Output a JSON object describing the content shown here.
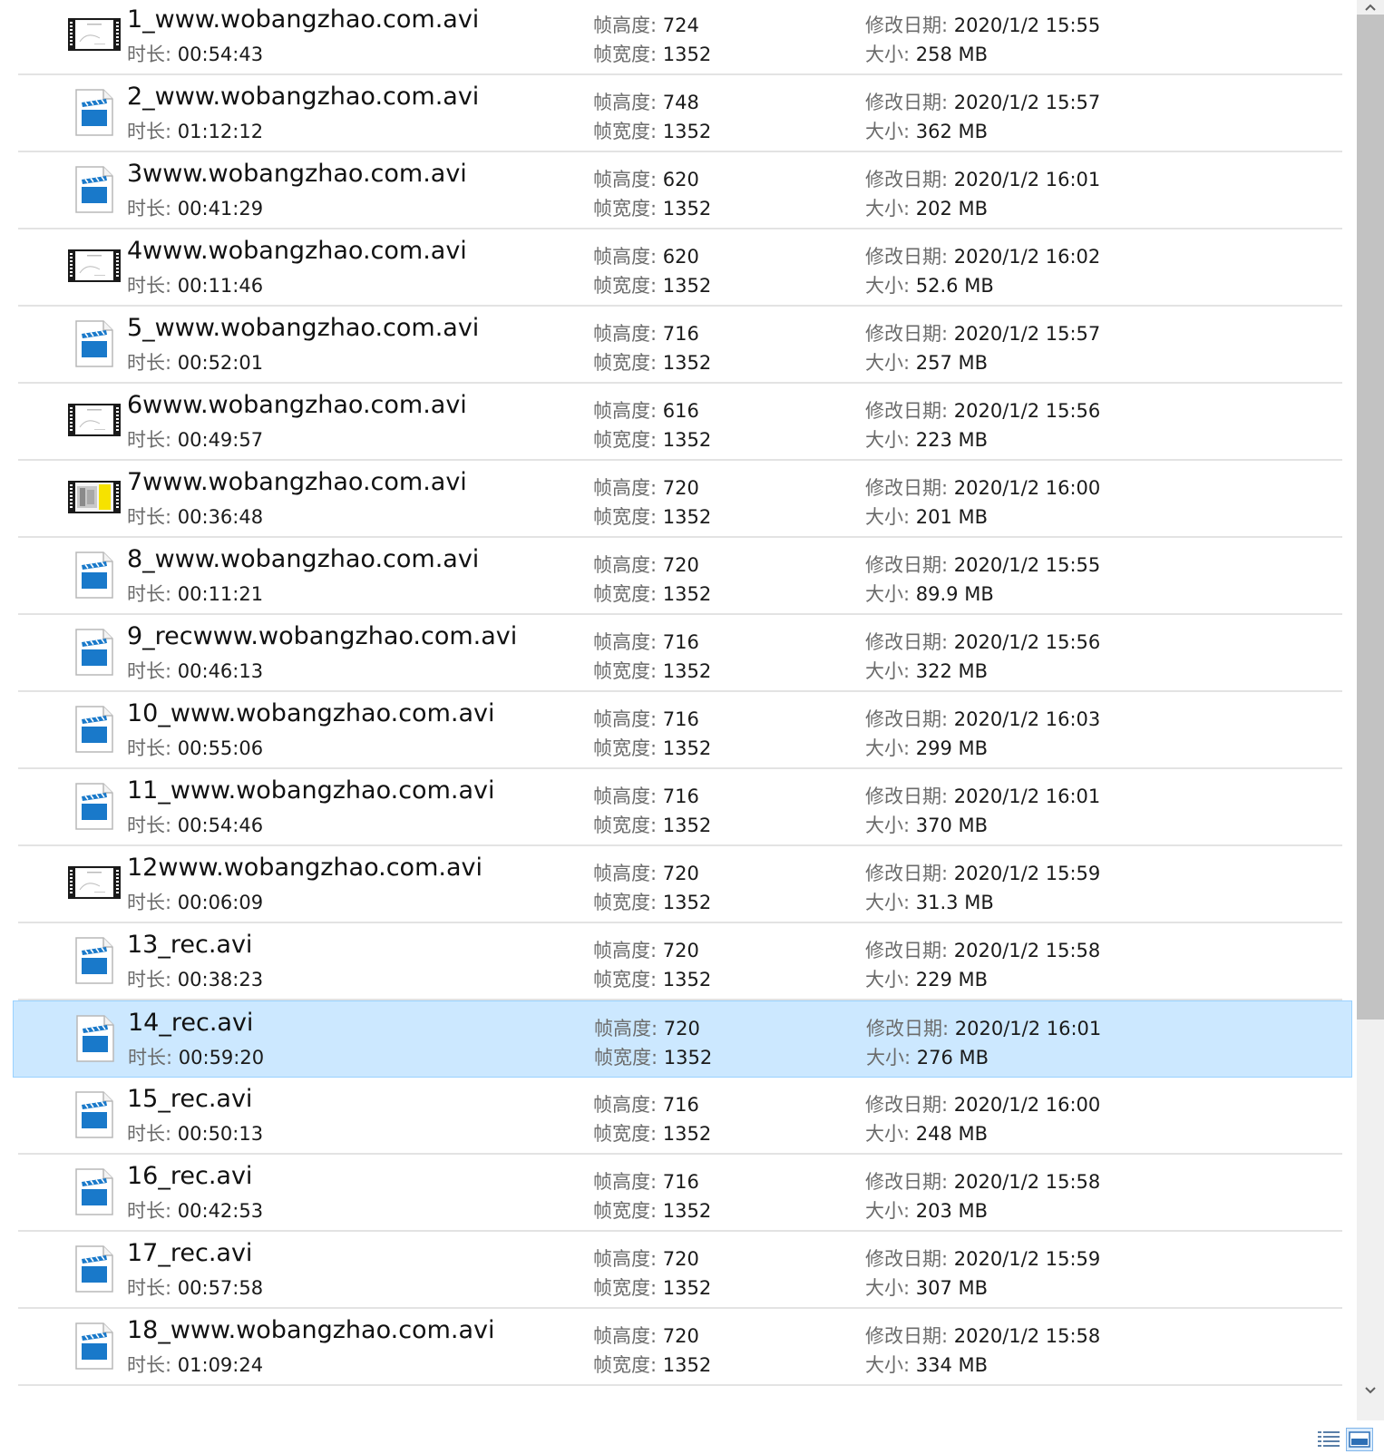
{
  "labels": {
    "duration": "时长: ",
    "frame_height": "帧高度: ",
    "frame_width": "帧宽度: ",
    "modified": "修改日期: ",
    "size": "大小: "
  },
  "files": [
    {
      "name": "1_www.wobangzhao.com.avi",
      "duration": "00:54:43",
      "frame_height": "724",
      "frame_width": "1352",
      "modified": "2020/1/2 15:55",
      "size": "258 MB",
      "thumb": "film-frame-icon"
    },
    {
      "name": "2_www.wobangzhao.com.avi",
      "duration": "01:12:12",
      "frame_height": "748",
      "frame_width": "1352",
      "modified": "2020/1/2 15:57",
      "size": "362 MB",
      "thumb": "video-file-icon"
    },
    {
      "name": "3www.wobangzhao.com.avi",
      "duration": "00:41:29",
      "frame_height": "620",
      "frame_width": "1352",
      "modified": "2020/1/2 16:01",
      "size": "202 MB",
      "thumb": "video-file-icon"
    },
    {
      "name": "4www.wobangzhao.com.avi",
      "duration": "00:11:46",
      "frame_height": "620",
      "frame_width": "1352",
      "modified": "2020/1/2 16:02",
      "size": "52.6 MB",
      "thumb": "film-frame-icon"
    },
    {
      "name": "5_www.wobangzhao.com.avi",
      "duration": "00:52:01",
      "frame_height": "716",
      "frame_width": "1352",
      "modified": "2020/1/2 15:57",
      "size": "257 MB",
      "thumb": "video-file-icon"
    },
    {
      "name": "6www.wobangzhao.com.avi",
      "duration": "00:49:57",
      "frame_height": "616",
      "frame_width": "1352",
      "modified": "2020/1/2 15:56",
      "size": "223 MB",
      "thumb": "film-frame-icon"
    },
    {
      "name": "7www.wobangzhao.com.avi",
      "duration": "00:36:48",
      "frame_height": "720",
      "frame_width": "1352",
      "modified": "2020/1/2 16:00",
      "size": "201 MB",
      "thumb": "film-frame-yellow-icon"
    },
    {
      "name": "8_www.wobangzhao.com.avi",
      "duration": "00:11:21",
      "frame_height": "720",
      "frame_width": "1352",
      "modified": "2020/1/2 15:55",
      "size": "89.9 MB",
      "thumb": "video-file-icon"
    },
    {
      "name": "9_recwww.wobangzhao.com.avi",
      "duration": "00:46:13",
      "frame_height": "716",
      "frame_width": "1352",
      "modified": "2020/1/2 15:56",
      "size": "322 MB",
      "thumb": "video-file-icon"
    },
    {
      "name": "10_www.wobangzhao.com.avi",
      "duration": "00:55:06",
      "frame_height": "716",
      "frame_width": "1352",
      "modified": "2020/1/2 16:03",
      "size": "299 MB",
      "thumb": "video-file-icon"
    },
    {
      "name": "11_www.wobangzhao.com.avi",
      "duration": "00:54:46",
      "frame_height": "716",
      "frame_width": "1352",
      "modified": "2020/1/2 16:01",
      "size": "370 MB",
      "thumb": "video-file-icon"
    },
    {
      "name": "12www.wobangzhao.com.avi",
      "duration": "00:06:09",
      "frame_height": "720",
      "frame_width": "1352",
      "modified": "2020/1/2 15:59",
      "size": "31.3 MB",
      "thumb": "film-frame-icon"
    },
    {
      "name": "13_rec.avi",
      "duration": "00:38:23",
      "frame_height": "720",
      "frame_width": "1352",
      "modified": "2020/1/2 15:58",
      "size": "229 MB",
      "thumb": "video-file-icon"
    },
    {
      "name": "14_rec.avi",
      "duration": "00:59:20",
      "frame_height": "720",
      "frame_width": "1352",
      "modified": "2020/1/2 16:01",
      "size": "276 MB",
      "thumb": "video-file-icon",
      "selected": true
    },
    {
      "name": "15_rec.avi",
      "duration": "00:50:13",
      "frame_height": "716",
      "frame_width": "1352",
      "modified": "2020/1/2 16:00",
      "size": "248 MB",
      "thumb": "video-file-icon"
    },
    {
      "name": "16_rec.avi",
      "duration": "00:42:53",
      "frame_height": "716",
      "frame_width": "1352",
      "modified": "2020/1/2 15:58",
      "size": "203 MB",
      "thumb": "video-file-icon"
    },
    {
      "name": "17_rec.avi",
      "duration": "00:57:58",
      "frame_height": "720",
      "frame_width": "1352",
      "modified": "2020/1/2 15:59",
      "size": "307 MB",
      "thumb": "video-file-icon"
    },
    {
      "name": "18_www.wobangzhao.com.avi",
      "duration": "01:09:24",
      "frame_height": "720",
      "frame_width": "1352",
      "modified": "2020/1/2 15:58",
      "size": "334 MB",
      "thumb": "video-file-icon"
    }
  ],
  "colors": {
    "selection_bg": "#cce8ff",
    "selection_border": "#99d1ff",
    "separator": "#e3e3e3",
    "label_gray": "#6b6b6b",
    "video_icon_blue": "#1979ca"
  }
}
